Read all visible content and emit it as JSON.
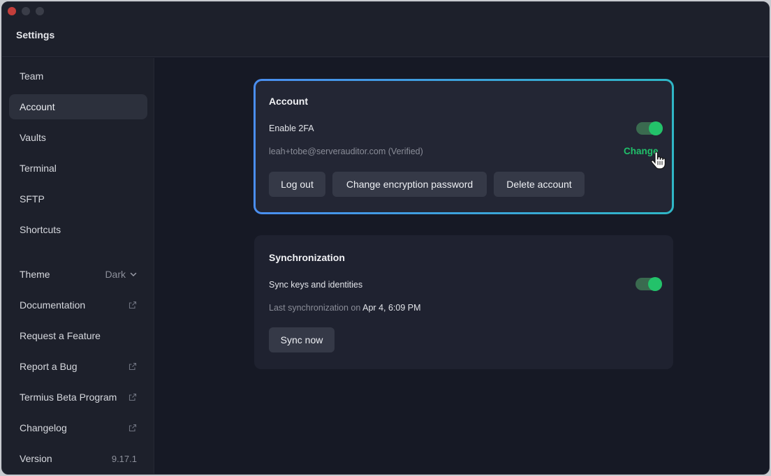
{
  "window": {
    "title": "Settings"
  },
  "sidebar": {
    "items": [
      {
        "label": "Team"
      },
      {
        "label": "Account"
      },
      {
        "label": "Vaults"
      },
      {
        "label": "Terminal"
      },
      {
        "label": "SFTP"
      },
      {
        "label": "Shortcuts"
      }
    ],
    "theme": {
      "label": "Theme",
      "value": "Dark"
    },
    "links": [
      {
        "label": "Documentation"
      },
      {
        "label": "Request a Feature"
      },
      {
        "label": "Report a Bug"
      },
      {
        "label": "Termius Beta Program"
      },
      {
        "label": "Changelog"
      }
    ],
    "version": {
      "label": "Version",
      "value": "9.17.1"
    }
  },
  "account": {
    "title": "Account",
    "twofa_label": "Enable 2FA",
    "twofa_enabled": true,
    "email": "leah+tobe@serverauditor.com (Verified)",
    "change_label": "Change",
    "buttons": {
      "logout": "Log out",
      "change_password": "Change encryption password",
      "delete": "Delete account"
    }
  },
  "sync": {
    "title": "Synchronization",
    "keys_label": "Sync keys and identities",
    "keys_enabled": true,
    "last_sync_prefix": "Last synchronization on",
    "last_sync_value": "Apr 4, 6:09 PM",
    "sync_now": "Sync now"
  },
  "colors": {
    "accent_green": "#20c06a",
    "highlight_gradient_start": "#4a8ef0",
    "highlight_gradient_end": "#2fb6c6"
  }
}
